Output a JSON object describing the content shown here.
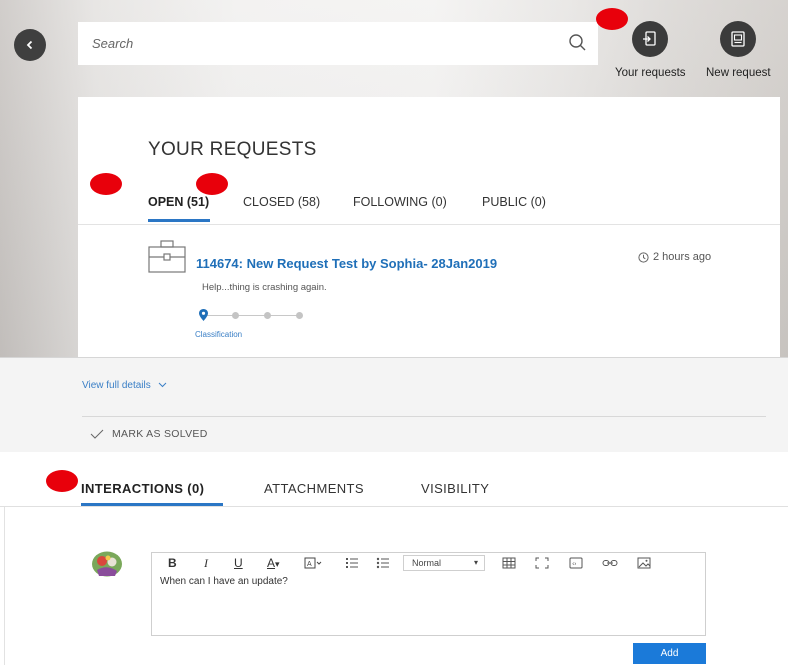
{
  "search": {
    "placeholder": "Search"
  },
  "header_actions": [
    {
      "label": "Your requests",
      "icon": "requests-icon"
    },
    {
      "label": "New request",
      "icon": "new-request-icon"
    }
  ],
  "page_title": "YOUR REQUESTS",
  "request_tabs": [
    {
      "label": "OPEN (51)",
      "active": true
    },
    {
      "label": "CLOSED (58)",
      "active": false
    },
    {
      "label": "FOLLOWING (0)",
      "active": false
    },
    {
      "label": "PUBLIC (0)",
      "active": false
    }
  ],
  "request": {
    "title": "114674: New Request Test by Sophia- 28Jan2019",
    "time": "2 hours ago",
    "description": "Help...thing is crashing again.",
    "progress": {
      "current_step": 1,
      "total_steps": 4,
      "current_label": "Classification"
    }
  },
  "details": {
    "view_full_details": "View full details",
    "mark_as_solved": "MARK AS SOLVED"
  },
  "detail_tabs": [
    {
      "label": "INTERACTIONS (0)",
      "active": true
    },
    {
      "label": "ATTACHMENTS",
      "active": false
    },
    {
      "label": "VISIBILITY",
      "active": false
    }
  ],
  "editor": {
    "toolbar": {
      "bold": "B",
      "italic": "I",
      "underline": "U",
      "font_color": "A",
      "format_select": "Normal"
    },
    "text": "When can I have an update?"
  },
  "add_button": "Add",
  "colors": {
    "accent": "#2b76c5",
    "link": "#1f6fb8",
    "button": "#1b7ad9",
    "marker": "#e8000b"
  }
}
